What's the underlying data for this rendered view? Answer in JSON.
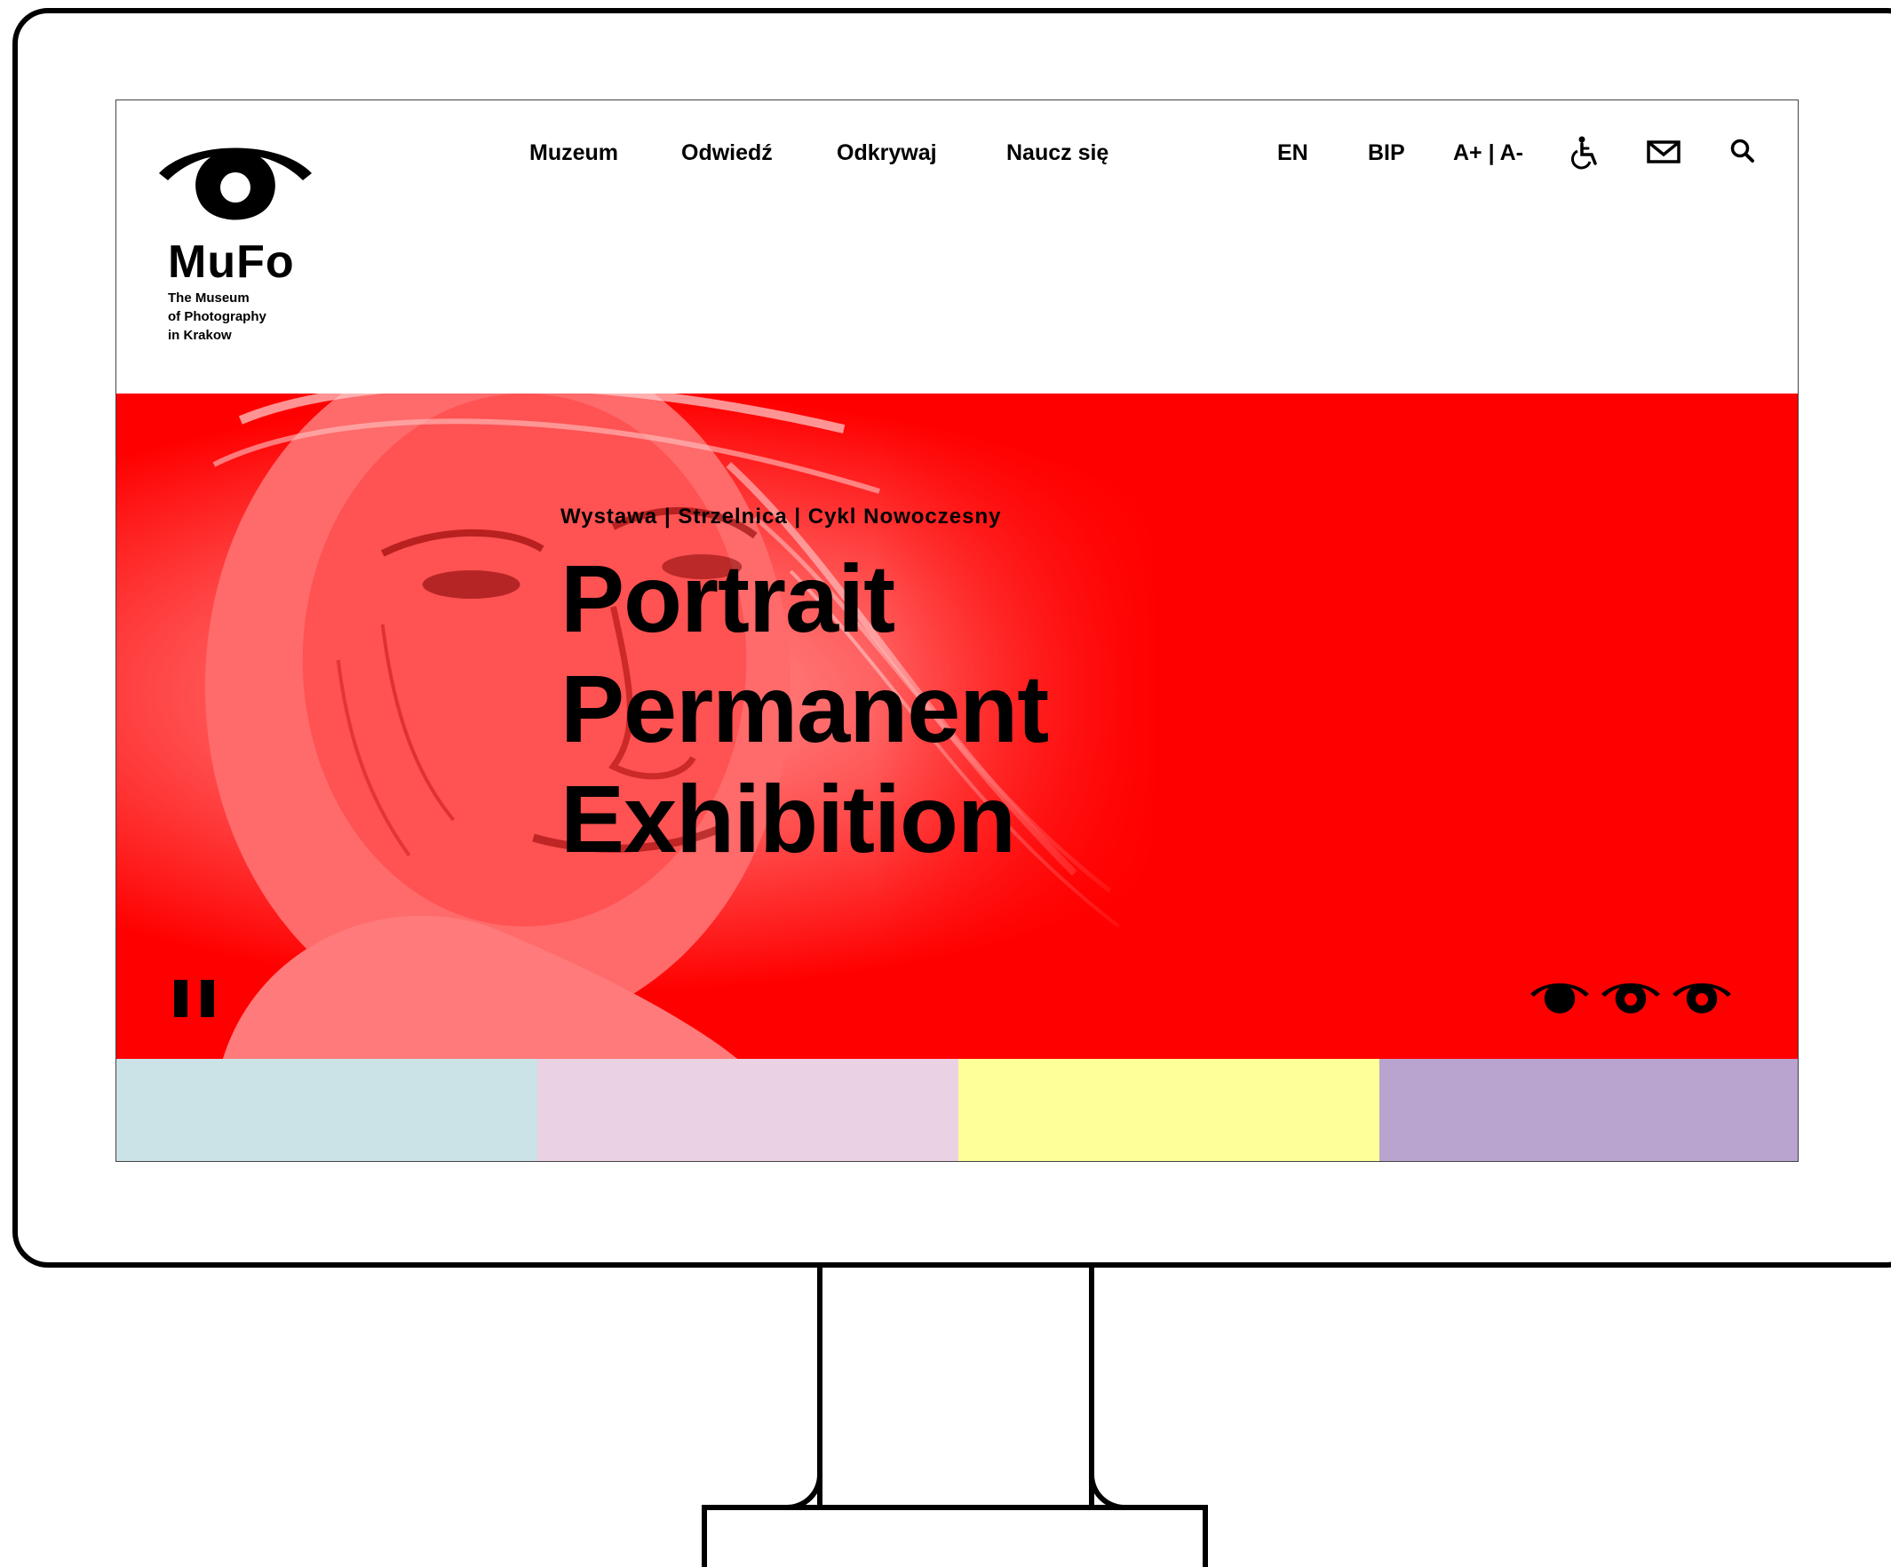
{
  "brand": {
    "name": "MuFo",
    "subtitle_lines": [
      "The Museum",
      "of Photography",
      "in Krakow"
    ]
  },
  "nav": {
    "items": [
      "Muzeum",
      "Odwiedź",
      "Odkrywaj",
      "Naucz się"
    ],
    "language": "EN",
    "bip": "BIP",
    "font_size": "A+ | A-"
  },
  "icons": {
    "accessibility": "wheelchair-icon",
    "contact": "envelope-icon",
    "search": "search-icon",
    "pause": "pause-icon",
    "slide_indicator": "eye-icon"
  },
  "hero": {
    "tagline": "Wystawa | Strzelnica | Cykl Nowoczesny",
    "title_lines": [
      "Portrait",
      "Permanent",
      "Exhibition"
    ],
    "background_color": "#ff0000",
    "slides": {
      "count": 3,
      "active_index": 0
    }
  },
  "tiles": {
    "colors": [
      "#cbe3e6",
      "#ead2e3",
      "#ffff99",
      "#b8a4cf"
    ]
  }
}
